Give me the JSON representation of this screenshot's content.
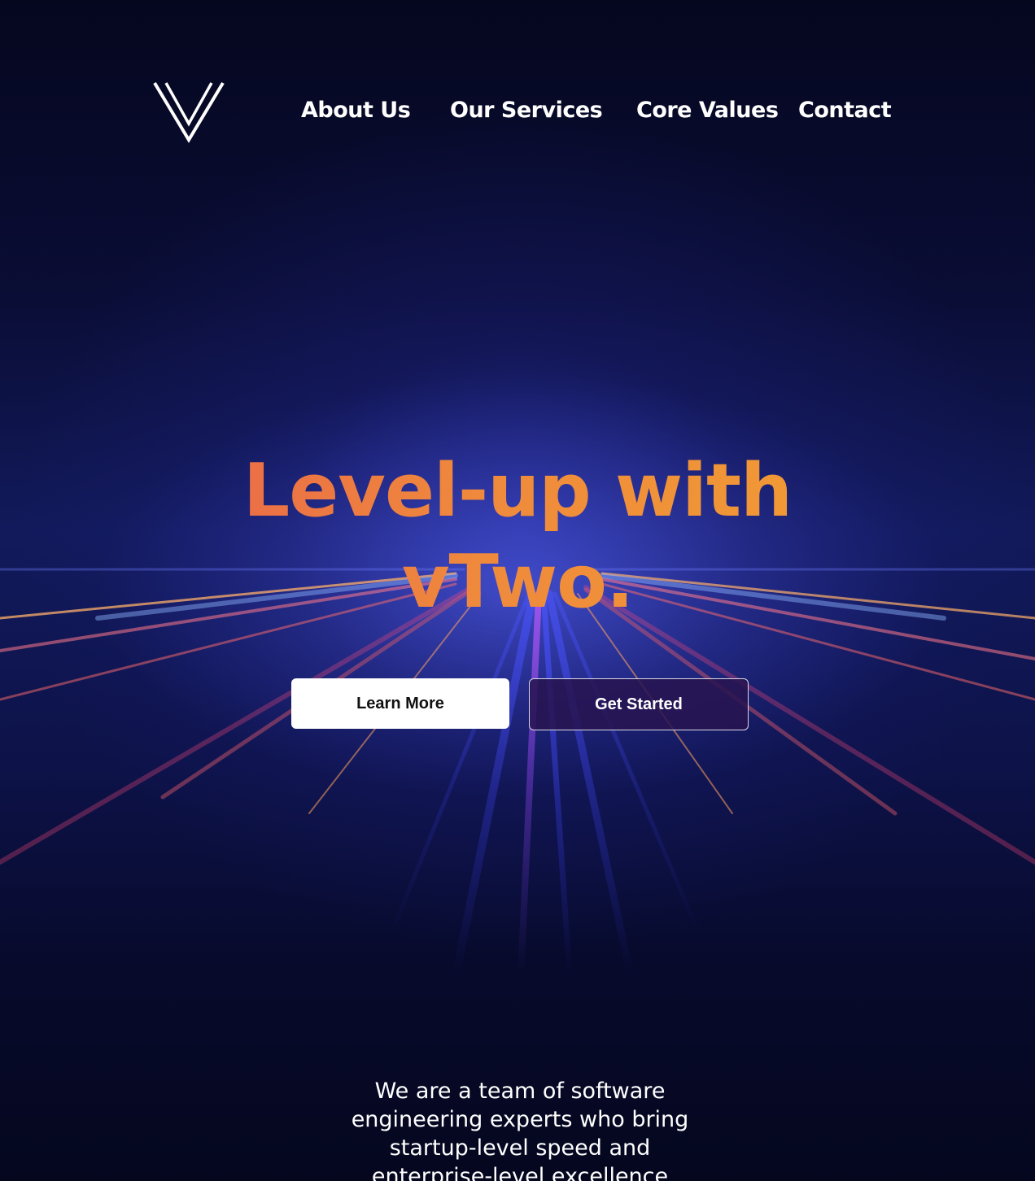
{
  "brand": {
    "logo_icon": "v-logo-icon"
  },
  "nav": {
    "items": [
      {
        "label": "About Us"
      },
      {
        "label": "Our Services"
      },
      {
        "label": "Core Values"
      },
      {
        "label": "Contact"
      }
    ]
  },
  "hero": {
    "title_line1": "Level-up with",
    "title_line2": "vTwo.",
    "learn_more_label": "Learn More",
    "get_started_label": "Get Started"
  },
  "about": {
    "text": "We are a team of software engineering experts who bring startup-level speed and enterprise-level excellence"
  },
  "colors": {
    "background": "#05071f",
    "title_gradient_start": "#ea6a48",
    "title_gradient_end": "#f19a35",
    "button_primary_bg": "#ffffff",
    "button_secondary_bg": "#281450"
  }
}
